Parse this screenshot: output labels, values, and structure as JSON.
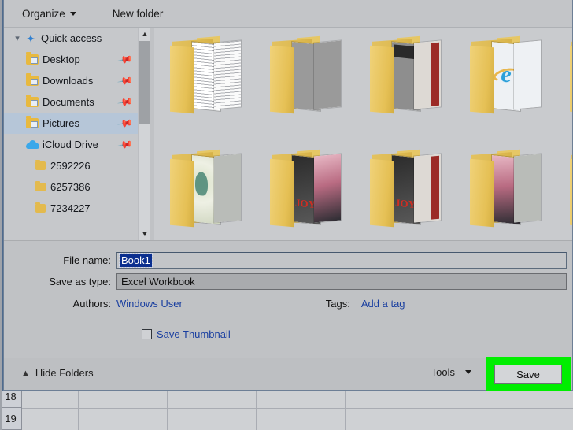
{
  "toolbar": {
    "organize_label": "Organize",
    "new_folder_label": "New folder"
  },
  "sidebar": {
    "items": [
      {
        "label": "Quick access",
        "icon": "star-icon",
        "expanded": true,
        "pinned": false,
        "selected": false
      },
      {
        "label": "Desktop",
        "icon": "folder-desktop-icon",
        "pinned": true,
        "selected": false
      },
      {
        "label": "Downloads",
        "icon": "folder-downloads-icon",
        "pinned": true,
        "selected": false
      },
      {
        "label": "Documents",
        "icon": "folder-documents-icon",
        "pinned": true,
        "selected": false
      },
      {
        "label": "Pictures",
        "icon": "folder-pictures-icon",
        "pinned": true,
        "selected": true
      },
      {
        "label": "iCloud Drive",
        "icon": "cloud-icon",
        "pinned": true,
        "selected": false
      },
      {
        "label": "2592226",
        "icon": "folder-icon",
        "pinned": false,
        "selected": false
      },
      {
        "label": "6257386",
        "icon": "folder-icon",
        "pinned": false,
        "selected": false
      },
      {
        "label": "7234227",
        "icon": "folder-icon",
        "pinned": false,
        "selected": false
      }
    ]
  },
  "filelist": {
    "items": [
      {
        "name": "folder-thumb-1",
        "content": "lines-doc"
      },
      {
        "name": "folder-thumb-2",
        "content": "gray-doc"
      },
      {
        "name": "folder-thumb-3",
        "content": "news-doc"
      },
      {
        "name": "folder-thumb-4",
        "content": "ie-doc"
      },
      {
        "name": "folder-thumb-5",
        "content": "photo-a"
      },
      {
        "name": "folder-thumb-6",
        "content": "photo-a"
      },
      {
        "name": "folder-thumb-7",
        "content": "poster-a"
      },
      {
        "name": "folder-thumb-8",
        "content": "poster-b"
      },
      {
        "name": "folder-thumb-9",
        "content": "cover-red"
      },
      {
        "name": "folder-thumb-10",
        "content": "photo-b"
      }
    ]
  },
  "form": {
    "file_name_label": "File name:",
    "file_name_value": "Book1",
    "save_as_type_label": "Save as type:",
    "save_as_type_value": "Excel Workbook",
    "authors_label": "Authors:",
    "authors_value": "Windows User",
    "tags_label": "Tags:",
    "tags_value": "Add a tag",
    "save_thumbnail_label": "Save Thumbnail",
    "save_thumbnail_checked": false
  },
  "bottom": {
    "hide_folders_label": "Hide Folders",
    "tools_label": "Tools",
    "save_label": "Save",
    "highlight_color": "#00ee00"
  },
  "excel": {
    "rows": [
      "18",
      "19"
    ]
  }
}
